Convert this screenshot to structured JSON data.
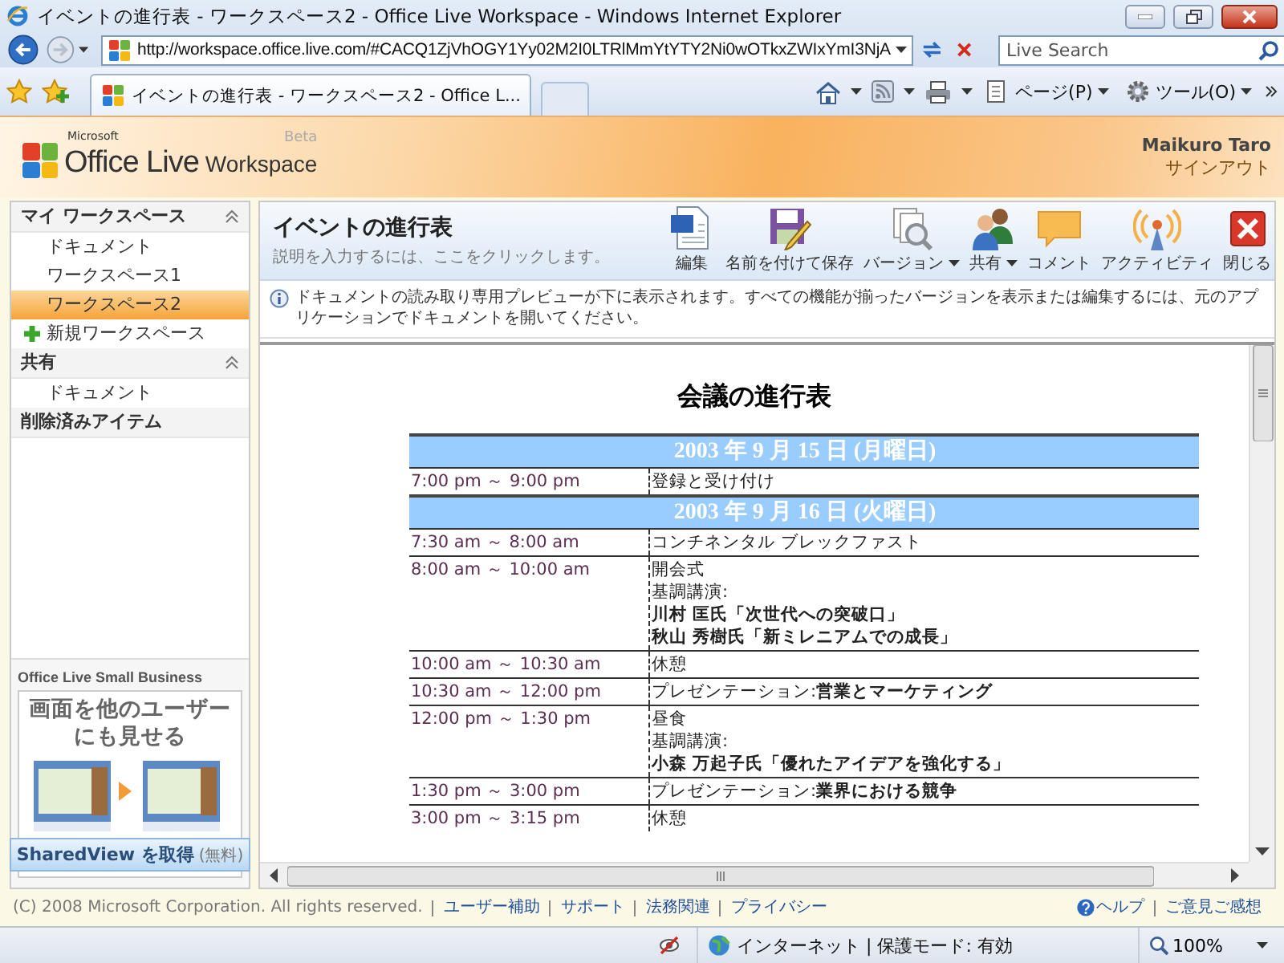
{
  "browser": {
    "title": "イベントの進行表 - ワークスペース2 - Office Live Workspace - Windows Internet Explorer",
    "address": "http://workspace.office.live.com/#CACQ1ZjVhOGY1Yy02M2I0LTRlMmYtYTY2Ni0wOTkxZWIxYmI3NjA",
    "search_placeholder": "Live Search",
    "tab_title": "イベントの進行表 - ワークスペース2 - Office L...",
    "commands": [
      "ページ(P)",
      "ツール(O)"
    ]
  },
  "header": {
    "brand_small": "Microsoft",
    "brand_main": "Office Live",
    "brand_sub": "Workspace",
    "brand_tag": "Beta",
    "user": "Maikuro Taro",
    "sign_out": "サインアウト"
  },
  "sidebar": {
    "sections": [
      {
        "title": "マイ ワークスペース",
        "expanded": true,
        "items": [
          {
            "label": "ドキュメント",
            "kind": "link",
            "selected": false
          },
          {
            "label": "ワークスペース1",
            "kind": "link",
            "selected": false
          },
          {
            "label": "ワークスペース2",
            "kind": "link",
            "selected": true
          },
          {
            "label": "新規ワークスペース",
            "kind": "add",
            "selected": false
          }
        ]
      },
      {
        "title": "共有",
        "expanded": true,
        "items": [
          {
            "label": "ドキュメント",
            "kind": "link",
            "selected": false
          }
        ]
      }
    ],
    "trash": "削除済みアイテム",
    "promo": {
      "title": "Office Live Small Business",
      "headline": "画面を他のユーザーにも見せる",
      "button": "SharedView を取得",
      "note": "(無料)"
    }
  },
  "document": {
    "title": "イベントの進行表",
    "description_hint": "説明を入力するには、ここをクリックします。",
    "actions": [
      {
        "label": "編集",
        "kind": "edit",
        "dropdown": false
      },
      {
        "label": "名前を付けて保存",
        "kind": "save_as",
        "dropdown": false
      },
      {
        "label": "バージョン",
        "kind": "versions",
        "dropdown": true
      },
      {
        "label": "共有",
        "kind": "share",
        "dropdown": true
      },
      {
        "label": "コメント",
        "kind": "comment",
        "dropdown": false
      },
      {
        "label": "アクティビティ",
        "kind": "activity",
        "dropdown": false
      },
      {
        "label": "閉じる",
        "kind": "close",
        "dropdown": false
      }
    ],
    "notice": "ドキュメントの読み取り専用プレビューが下に表示されます。すべての機能が揃ったバージョンを表示または編集するには、元のアプリケーションでドキュメントを開いてください。",
    "preview": {
      "heading": "会議の進行表",
      "rows": [
        {
          "kind": "date",
          "text": "2003 年 9 月 15 日 (月曜日)"
        },
        {
          "kind": "session",
          "time": "7:00 pm ～ 9:00 pm",
          "lines": [
            {
              "text": "登録と受け付け",
              "bold": false
            }
          ]
        },
        {
          "kind": "date",
          "text": "2003 年 9 月 16 日 (火曜日)"
        },
        {
          "kind": "session",
          "time": "7:30 am ～ 8:00 am",
          "lines": [
            {
              "text": "コンチネンタル ブレックファスト",
              "bold": false
            }
          ]
        },
        {
          "kind": "session",
          "time": "8:00 am ～ 10:00 am",
          "lines": [
            {
              "text": "開会式",
              "bold": false
            },
            {
              "text": "基調講演:",
              "bold": false
            },
            {
              "text": "川村 匡氏「次世代への突破口」",
              "bold": true
            },
            {
              "text": "秋山 秀樹氏「新ミレニアムでの成長」",
              "bold": true
            }
          ]
        },
        {
          "kind": "session",
          "time": "10:00 am ～ 10:30 am",
          "lines": [
            {
              "text": "休憩",
              "bold": false
            }
          ]
        },
        {
          "kind": "session",
          "time": "10:30 am ～ 12:00 pm",
          "lines": [
            {
              "text": "プレゼンテーション:**営業とマーケティング**",
              "bold": false
            }
          ]
        },
        {
          "kind": "session",
          "time": "12:00 pm ～ 1:30 pm",
          "lines": [
            {
              "text": "昼食",
              "bold": false
            },
            {
              "text": "基調講演:",
              "bold": false
            },
            {
              "text": "小森 万起子氏「優れたアイデアを強化する」",
              "bold": true
            }
          ]
        },
        {
          "kind": "session",
          "time": "1:30 pm ～ 3:00 pm",
          "lines": [
            {
              "text": "プレゼンテーション:**業界における競争**",
              "bold": false
            }
          ]
        },
        {
          "kind": "session",
          "time": "3:00 pm ～ 3:15 pm",
          "lines": [
            {
              "text": "休憩",
              "bold": false
            }
          ]
        }
      ]
    }
  },
  "footer": {
    "copyright": "(C) 2008 Microsoft Corporation. All rights reserved.",
    "links": [
      "ユーザー補助",
      "サポート",
      "法務関連",
      "プライバシー"
    ],
    "help": "ヘルプ",
    "feedback": "ご意見ご感想"
  },
  "status_bar": {
    "zone": "インターネット | 保護モード: 有効",
    "zoom": "100%"
  }
}
